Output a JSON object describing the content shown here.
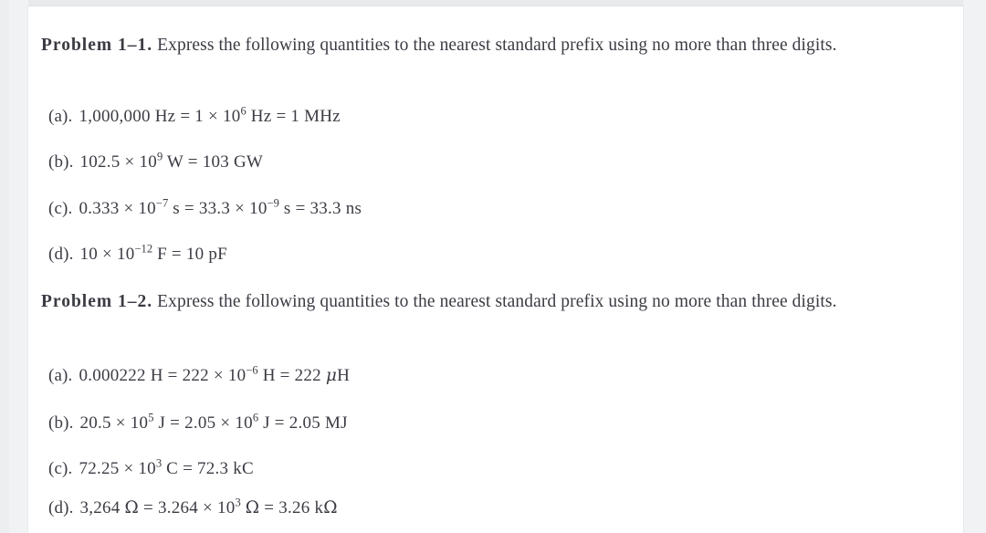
{
  "document": {
    "background_color": "#f1f2f4",
    "page_color": "#ffffff",
    "text_color": "#3b3b44"
  },
  "problems": [
    {
      "label": "Problem 1–1.",
      "statement": "Express the following quantities to the nearest standard prefix using no more than three digits.",
      "items": [
        {
          "tag": "(a).",
          "expr_html": "1,000,000 Hz = 1 × 10<sup>6</sup> Hz = 1 MHz",
          "expr_text": "1,000,000 Hz = 1 × 10^6 Hz = 1 MHz"
        },
        {
          "tag": "(b).",
          "expr_html": "102.5 × 10<sup>9</sup> W = 103 GW",
          "expr_text": "102.5 × 10^9 W = 103 GW"
        },
        {
          "tag": "(c).",
          "expr_html": "0.333 × 10<sup>−7</sup> s = 33.3 × 10<sup>−9</sup> s = 33.3 ns",
          "expr_text": "0.333 × 10^-7 s = 33.3 × 10^-9 s = 33.3 ns"
        },
        {
          "tag": "(d).",
          "expr_html": "10 × 10<sup>−12</sup> F = 10 pF",
          "expr_text": "10 × 10^-12 F = 10 pF"
        }
      ]
    },
    {
      "label": "Problem 1–2.",
      "statement": "Express the following quantities to the nearest standard prefix using no more than three digits.",
      "items": [
        {
          "tag": "(a).",
          "expr_html": "0.000222 H = 222 × 10<sup>−6</sup> H = 222 <span class=\"mu\">μ</span>H",
          "expr_text": "0.000222 H = 222 × 10^-6 H = 222 μH"
        },
        {
          "tag": "(b).",
          "expr_html": "20.5 × 10<sup>5</sup> J = 2.05 × 10<sup>6</sup> J = 2.05 MJ",
          "expr_text": "20.5 × 10^5 J = 2.05 × 10^6 J = 2.05 MJ"
        },
        {
          "tag": "(c).",
          "expr_html": "72.25 × 10<sup>3</sup> C = 72.3 kC",
          "expr_text": "72.25 × 10^3 C = 72.3 kC"
        },
        {
          "tag": "(d).",
          "expr_html": "3,264 <span class=\"ohm\">Ω</span> = 3.264 × 10<sup>3</sup> <span class=\"ohm\">Ω</span> = 3.26 k<span class=\"ohm\">Ω</span>",
          "expr_text": "3,264 Ω = 3.264 × 10^3 Ω = 3.26 kΩ"
        }
      ]
    }
  ]
}
